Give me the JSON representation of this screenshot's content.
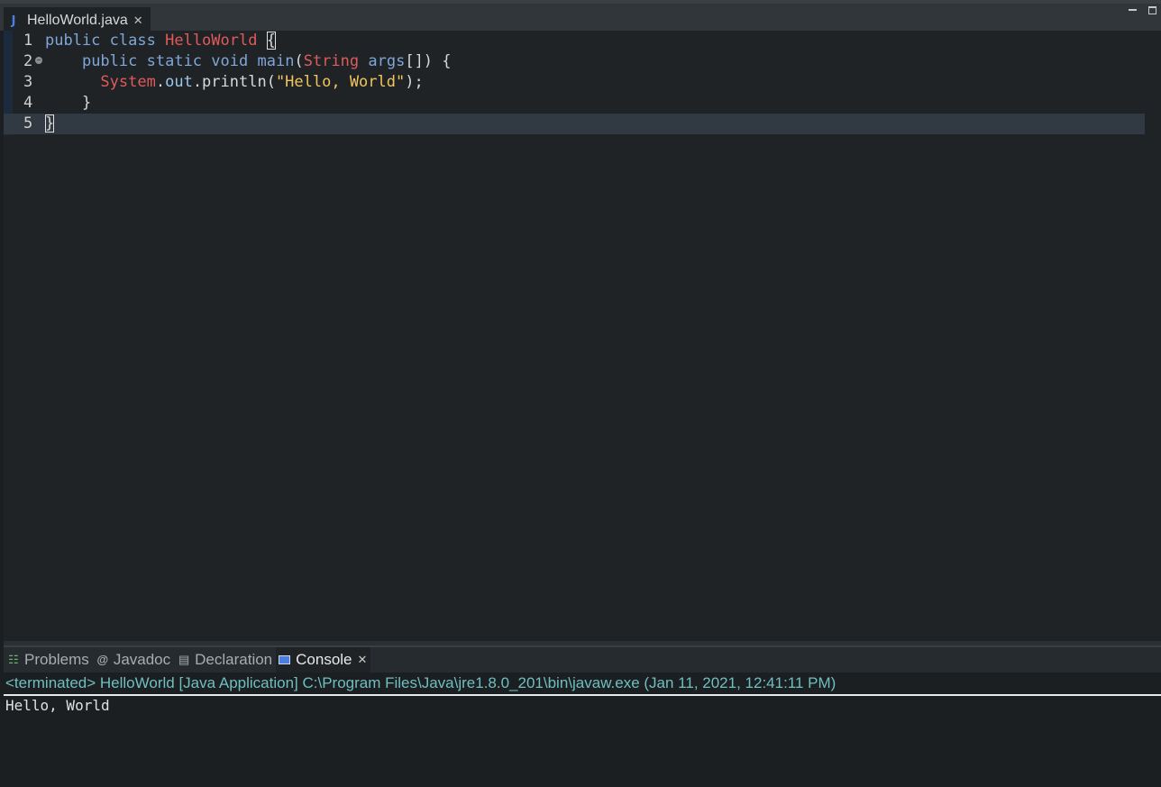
{
  "editor": {
    "tab": {
      "icon": "java-file-icon",
      "label": "HelloWorld.java"
    },
    "window_controls": [
      "minimize-icon",
      "maximize-icon"
    ],
    "lines": [
      {
        "number": "1",
        "tokens": [
          {
            "t": "public",
            "c": "kw"
          },
          {
            "t": " ",
            "c": "plain"
          },
          {
            "t": "class",
            "c": "kw"
          },
          {
            "t": " ",
            "c": "plain"
          },
          {
            "t": "HelloWorld",
            "c": "cls"
          },
          {
            "t": " ",
            "c": "plain"
          },
          {
            "t": "{",
            "c": "plain bracket-hl"
          }
        ]
      },
      {
        "number": "2",
        "fold": true,
        "tokens": [
          {
            "t": "    ",
            "c": "plain"
          },
          {
            "t": "public",
            "c": "kw"
          },
          {
            "t": " ",
            "c": "plain"
          },
          {
            "t": "static",
            "c": "kw"
          },
          {
            "t": " ",
            "c": "plain"
          },
          {
            "t": "void",
            "c": "kw"
          },
          {
            "t": " ",
            "c": "plain"
          },
          {
            "t": "main",
            "c": "kw"
          },
          {
            "t": "(",
            "c": "plain"
          },
          {
            "t": "String",
            "c": "cls"
          },
          {
            "t": " ",
            "c": "plain"
          },
          {
            "t": "args",
            "c": "param"
          },
          {
            "t": "[]) {",
            "c": "plain"
          }
        ]
      },
      {
        "number": "3",
        "tokens": [
          {
            "t": "      ",
            "c": "plain"
          },
          {
            "t": "System",
            "c": "cls"
          },
          {
            "t": ".",
            "c": "plain"
          },
          {
            "t": "out",
            "c": "fld"
          },
          {
            "t": ".println(",
            "c": "plain"
          },
          {
            "t": "\"Hello, World\"",
            "c": "str"
          },
          {
            "t": ");",
            "c": "plain"
          }
        ]
      },
      {
        "number": "4",
        "tokens": [
          {
            "t": "    }",
            "c": "plain"
          }
        ]
      },
      {
        "number": "5",
        "current": true,
        "tokens": [
          {
            "t": "}",
            "c": "plain bracket-hl"
          }
        ]
      }
    ]
  },
  "views": {
    "tabs": [
      {
        "label": "Problems",
        "icon": "problems-icon",
        "active": false
      },
      {
        "label": "Javadoc",
        "icon": "javadoc-icon",
        "active": false
      },
      {
        "label": "Declaration",
        "icon": "declaration-icon",
        "active": false
      },
      {
        "label": "Console",
        "icon": "console-icon",
        "active": true
      }
    ],
    "console": {
      "header": "<terminated> HelloWorld [Java Application] C:\\Program Files\\Java\\jre1.8.0_201\\bin\\javaw.exe (Jan 11, 2021, 12:41:11 PM)",
      "output": "Hello, World"
    }
  },
  "colors": {
    "background": "#1b1f22",
    "editor_bg": "#1f2326",
    "keyword": "#7fa6d8",
    "type": "#e05a5a",
    "string": "#f2c55c",
    "console_header": "#6fbfc0"
  }
}
